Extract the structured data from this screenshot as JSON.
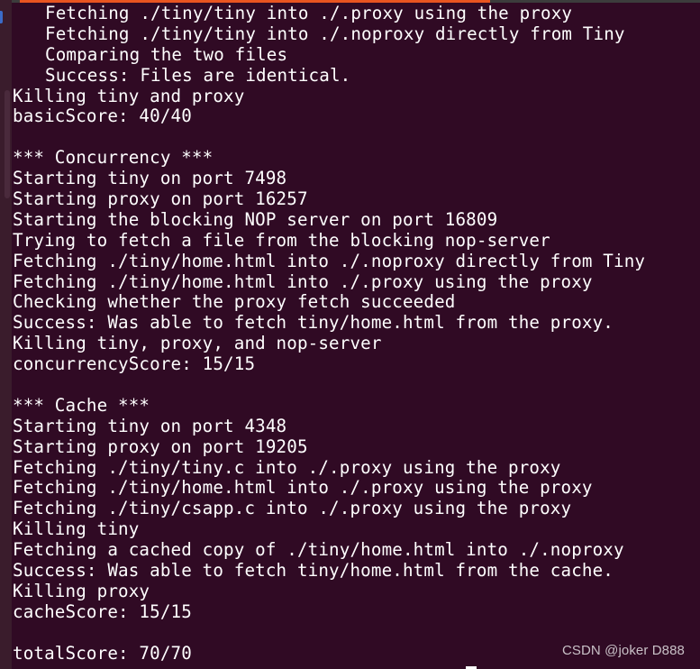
{
  "window": {
    "app": "Terminal",
    "accent_color": "#e95420",
    "background_color": "#300a24",
    "text_color": "#ffffff"
  },
  "terminal": {
    "lines": [
      {
        "text": "Fetching ./tiny/tiny into ./.proxy using the proxy",
        "indent": true
      },
      {
        "text": "Fetching ./tiny/tiny into ./.noproxy directly from Tiny",
        "indent": true
      },
      {
        "text": "Comparing the two files",
        "indent": true
      },
      {
        "text": "Success: Files are identical.",
        "indent": true
      },
      {
        "text": "Killing tiny and proxy",
        "indent": false
      },
      {
        "text": "basicScore: 40/40",
        "indent": false
      },
      {
        "text": "",
        "indent": false
      },
      {
        "text": "*** Concurrency ***",
        "indent": false
      },
      {
        "text": "Starting tiny on port 7498",
        "indent": false
      },
      {
        "text": "Starting proxy on port 16257",
        "indent": false
      },
      {
        "text": "Starting the blocking NOP server on port 16809",
        "indent": false
      },
      {
        "text": "Trying to fetch a file from the blocking nop-server",
        "indent": false
      },
      {
        "text": "Fetching ./tiny/home.html into ./.noproxy directly from Tiny",
        "indent": false
      },
      {
        "text": "Fetching ./tiny/home.html into ./.proxy using the proxy",
        "indent": false
      },
      {
        "text": "Checking whether the proxy fetch succeeded",
        "indent": false
      },
      {
        "text": "Success: Was able to fetch tiny/home.html from the proxy.",
        "indent": false
      },
      {
        "text": "Killing tiny, proxy, and nop-server",
        "indent": false
      },
      {
        "text": "concurrencyScore: 15/15",
        "indent": false
      },
      {
        "text": "",
        "indent": false
      },
      {
        "text": "*** Cache ***",
        "indent": false
      },
      {
        "text": "Starting tiny on port 4348",
        "indent": false
      },
      {
        "text": "Starting proxy on port 19205",
        "indent": false
      },
      {
        "text": "Fetching ./tiny/tiny.c into ./.proxy using the proxy",
        "indent": false
      },
      {
        "text": "Fetching ./tiny/home.html into ./.proxy using the proxy",
        "indent": false
      },
      {
        "text": "Fetching ./tiny/csapp.c into ./.proxy using the proxy",
        "indent": false
      },
      {
        "text": "Killing tiny",
        "indent": false
      },
      {
        "text": "Fetching a cached copy of ./tiny/home.html into ./.noproxy",
        "indent": false
      },
      {
        "text": "Success: Was able to fetch tiny/home.html from the cache.",
        "indent": false
      },
      {
        "text": "Killing proxy",
        "indent": false
      },
      {
        "text": "cacheScore: 15/15",
        "indent": false
      },
      {
        "text": "",
        "indent": false
      },
      {
        "text": "totalScore: 70/70",
        "indent": false
      }
    ]
  },
  "watermark": "CSDN @joker D888"
}
